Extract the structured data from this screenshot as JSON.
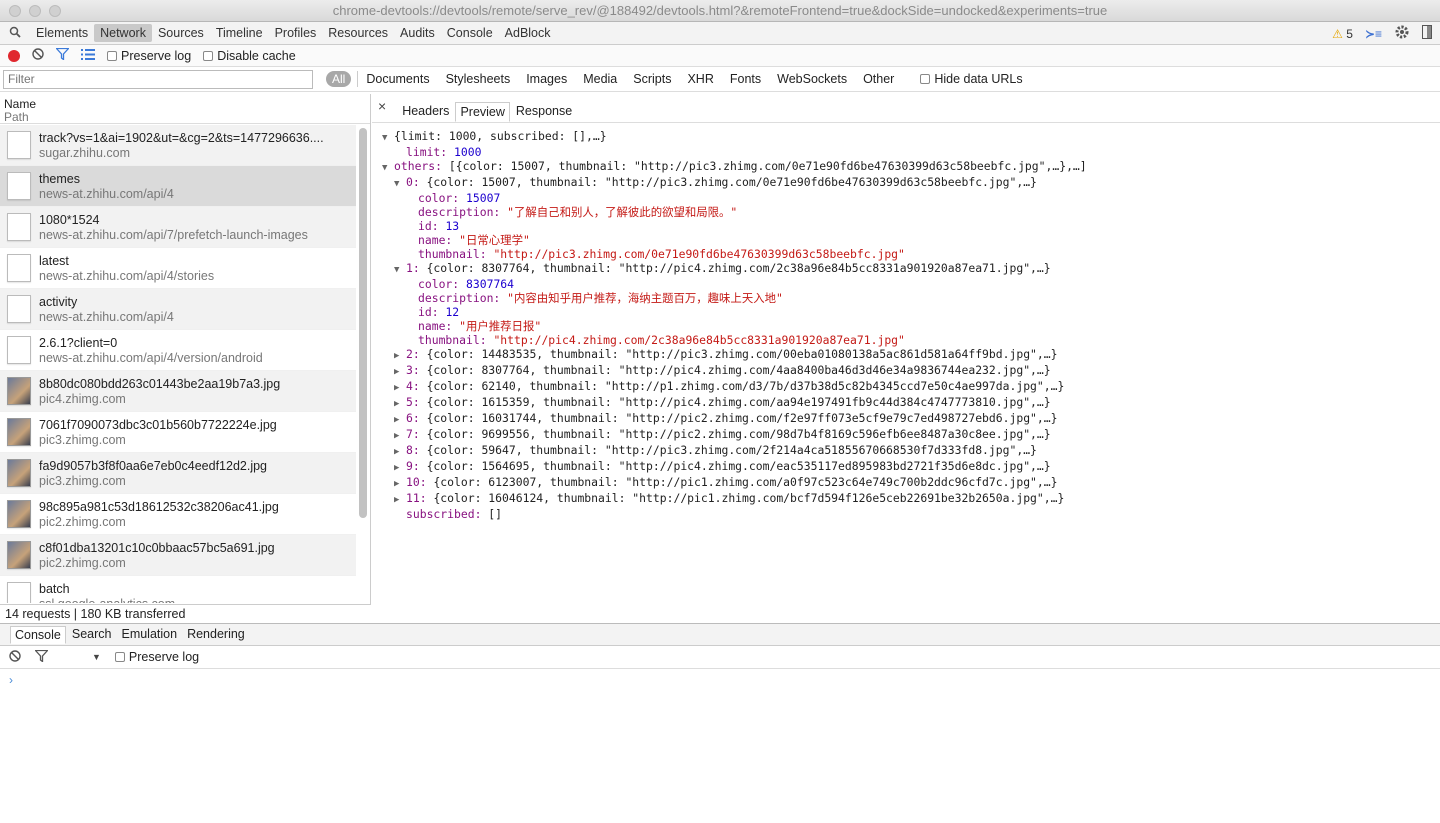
{
  "window": {
    "title": "chrome-devtools://devtools/remote/serve_rev/@188492/devtools.html?&remoteFrontend=true&dockSide=undocked&experiments=true"
  },
  "main_tabs": [
    "Elements",
    "Network",
    "Sources",
    "Timeline",
    "Profiles",
    "Resources",
    "Audits",
    "Console",
    "AdBlock"
  ],
  "active_main_tab": "Network",
  "warnings_count": "5",
  "network_toolbar": {
    "preserve_log_label": "Preserve log",
    "disable_cache_label": "Disable cache"
  },
  "filter": {
    "placeholder": "Filter",
    "all_label": "All",
    "types": [
      "Documents",
      "Stylesheets",
      "Images",
      "Media",
      "Scripts",
      "XHR",
      "Fonts",
      "WebSockets",
      "Other"
    ],
    "hide_data_urls_label": "Hide data URLs"
  },
  "list_header": {
    "name": "Name",
    "path": "Path"
  },
  "requests": [
    {
      "name": "track?vs=1&ai=1902&ut=&cg=2&ts=1477296636....",
      "path": "sugar.zhihu.com",
      "icon": "document-icon"
    },
    {
      "name": "themes",
      "path": "news-at.zhihu.com/api/4",
      "icon": "document-icon",
      "selected": true
    },
    {
      "name": "1080*1524",
      "path": "news-at.zhihu.com/api/7/prefetch-launch-images",
      "icon": "document-icon"
    },
    {
      "name": "latest",
      "path": "news-at.zhihu.com/api/4/stories",
      "icon": "document-icon"
    },
    {
      "name": "activity",
      "path": "news-at.zhihu.com/api/4",
      "icon": "document-icon"
    },
    {
      "name": "2.6.1?client=0",
      "path": "news-at.zhihu.com/api/4/version/android",
      "icon": "document-icon"
    },
    {
      "name": "8b80dc080bdd263c01443be2aa19b7a3.jpg",
      "path": "pic4.zhimg.com",
      "icon": "image-thumbnail-icon"
    },
    {
      "name": "7061f7090073dbc3c01b560b7722224e.jpg",
      "path": "pic3.zhimg.com",
      "icon": "image-thumbnail-icon"
    },
    {
      "name": "fa9d9057b3f8f0aa6e7eb0c4eedf12d2.jpg",
      "path": "pic3.zhimg.com",
      "icon": "image-thumbnail-icon"
    },
    {
      "name": "98c895a981c53d18612532c38206ac41.jpg",
      "path": "pic2.zhimg.com",
      "icon": "image-thumbnail-icon"
    },
    {
      "name": "c8f01dba13201c10c0bbaac57bc5a691.jpg",
      "path": "pic2.zhimg.com",
      "icon": "image-thumbnail-icon"
    },
    {
      "name": "batch",
      "path": "ssl.google-analytics.com",
      "icon": "document-icon"
    }
  ],
  "summary": "14 requests | 180 KB transferred",
  "detail_tabs": [
    "Headers",
    "Preview",
    "Response"
  ],
  "active_detail_tab": "Preview",
  "preview_lines": [
    {
      "indent": 0,
      "arrow": "▼",
      "parts": [
        [
          "plain",
          "{limit: 1000, subscribed: [],…}"
        ]
      ]
    },
    {
      "indent": 1,
      "arrow": "",
      "parts": [
        [
          "key",
          "limit: "
        ],
        [
          "num",
          "1000"
        ]
      ]
    },
    {
      "indent": 0,
      "arrow": "▼",
      "parts": [
        [
          "key",
          "others: "
        ],
        [
          "plain",
          "[{color: 15007, thumbnail: \"http://pic3.zhimg.com/0e71e90fd6be47630399d63c58beebfc.jpg\",…},…]"
        ]
      ]
    },
    {
      "indent": 1,
      "arrow": "▼",
      "parts": [
        [
          "key",
          "0: "
        ],
        [
          "plain",
          "{color: 15007, thumbnail: \"http://pic3.zhimg.com/0e71e90fd6be47630399d63c58beebfc.jpg\",…}"
        ]
      ]
    },
    {
      "indent": 2,
      "arrow": "",
      "parts": [
        [
          "key",
          "color: "
        ],
        [
          "num",
          "15007"
        ]
      ]
    },
    {
      "indent": 2,
      "arrow": "",
      "parts": [
        [
          "key",
          "description: "
        ],
        [
          "str",
          "\"了解自己和别人，了解彼此的欲望和局限。\""
        ]
      ]
    },
    {
      "indent": 2,
      "arrow": "",
      "parts": [
        [
          "key",
          "id: "
        ],
        [
          "num",
          "13"
        ]
      ]
    },
    {
      "indent": 2,
      "arrow": "",
      "parts": [
        [
          "key",
          "name: "
        ],
        [
          "str",
          "\"日常心理学\""
        ]
      ]
    },
    {
      "indent": 2,
      "arrow": "",
      "parts": [
        [
          "key",
          "thumbnail: "
        ],
        [
          "str",
          "\"http://pic3.zhimg.com/0e71e90fd6be47630399d63c58beebfc.jpg\""
        ]
      ]
    },
    {
      "indent": 1,
      "arrow": "▼",
      "parts": [
        [
          "key",
          "1: "
        ],
        [
          "plain",
          "{color: 8307764, thumbnail: \"http://pic4.zhimg.com/2c38a96e84b5cc8331a901920a87ea71.jpg\",…}"
        ]
      ]
    },
    {
      "indent": 2,
      "arrow": "",
      "parts": [
        [
          "key",
          "color: "
        ],
        [
          "num",
          "8307764"
        ]
      ]
    },
    {
      "indent": 2,
      "arrow": "",
      "parts": [
        [
          "key",
          "description: "
        ],
        [
          "str",
          "\"内容由知乎用户推荐，海纳主题百万，趣味上天入地\""
        ]
      ]
    },
    {
      "indent": 2,
      "arrow": "",
      "parts": [
        [
          "key",
          "id: "
        ],
        [
          "num",
          "12"
        ]
      ]
    },
    {
      "indent": 2,
      "arrow": "",
      "parts": [
        [
          "key",
          "name: "
        ],
        [
          "str",
          "\"用户推荐日报\""
        ]
      ]
    },
    {
      "indent": 2,
      "arrow": "",
      "parts": [
        [
          "key",
          "thumbnail: "
        ],
        [
          "str",
          "\"http://pic4.zhimg.com/2c38a96e84b5cc8331a901920a87ea71.jpg\""
        ]
      ]
    },
    {
      "indent": 1,
      "arrow": "▶",
      "parts": [
        [
          "key",
          "2: "
        ],
        [
          "plain",
          "{color: 14483535, thumbnail: \"http://pic3.zhimg.com/00eba01080138a5ac861d581a64ff9bd.jpg\",…}"
        ]
      ]
    },
    {
      "indent": 1,
      "arrow": "▶",
      "parts": [
        [
          "key",
          "3: "
        ],
        [
          "plain",
          "{color: 8307764, thumbnail: \"http://pic4.zhimg.com/4aa8400ba46d3d46e34a9836744ea232.jpg\",…}"
        ]
      ]
    },
    {
      "indent": 1,
      "arrow": "▶",
      "parts": [
        [
          "key",
          "4: "
        ],
        [
          "plain",
          "{color: 62140, thumbnail: \"http://p1.zhimg.com/d3/7b/d37b38d5c82b4345ccd7e50c4ae997da.jpg\",…}"
        ]
      ]
    },
    {
      "indent": 1,
      "arrow": "▶",
      "parts": [
        [
          "key",
          "5: "
        ],
        [
          "plain",
          "{color: 1615359, thumbnail: \"http://pic4.zhimg.com/aa94e197491fb9c44d384c4747773810.jpg\",…}"
        ]
      ]
    },
    {
      "indent": 1,
      "arrow": "▶",
      "parts": [
        [
          "key",
          "6: "
        ],
        [
          "plain",
          "{color: 16031744, thumbnail: \"http://pic2.zhimg.com/f2e97ff073e5cf9e79c7ed498727ebd6.jpg\",…}"
        ]
      ]
    },
    {
      "indent": 1,
      "arrow": "▶",
      "parts": [
        [
          "key",
          "7: "
        ],
        [
          "plain",
          "{color: 9699556, thumbnail: \"http://pic2.zhimg.com/98d7b4f8169c596efb6ee8487a30c8ee.jpg\",…}"
        ]
      ]
    },
    {
      "indent": 1,
      "arrow": "▶",
      "parts": [
        [
          "key",
          "8: "
        ],
        [
          "plain",
          "{color: 59647, thumbnail: \"http://pic3.zhimg.com/2f214a4ca51855670668530f7d333fd8.jpg\",…}"
        ]
      ]
    },
    {
      "indent": 1,
      "arrow": "▶",
      "parts": [
        [
          "key",
          "9: "
        ],
        [
          "plain",
          "{color: 1564695, thumbnail: \"http://pic4.zhimg.com/eac535117ed895983bd2721f35d6e8dc.jpg\",…}"
        ]
      ]
    },
    {
      "indent": 1,
      "arrow": "▶",
      "parts": [
        [
          "key",
          "10: "
        ],
        [
          "plain",
          "{color: 6123007, thumbnail: \"http://pic1.zhimg.com/a0f97c523c64e749c700b2ddc96cfd7c.jpg\",…}"
        ]
      ]
    },
    {
      "indent": 1,
      "arrow": "▶",
      "parts": [
        [
          "key",
          "11: "
        ],
        [
          "plain",
          "{color: 16046124, thumbnail: \"http://pic1.zhimg.com/bcf7d594f126e5ceb22691be32b2650a.jpg\",…}"
        ]
      ]
    },
    {
      "indent": 1,
      "arrow": "",
      "parts": [
        [
          "key",
          "subscribed: "
        ],
        [
          "plain",
          "[]"
        ]
      ]
    }
  ],
  "drawer_tabs": [
    "Console",
    "Search",
    "Emulation",
    "Rendering"
  ],
  "active_drawer_tab": "Console",
  "drawer_toolbar": {
    "preserve_log_label": "Preserve log"
  },
  "console_prompt": "›",
  "colors": {
    "record": "#e0282e",
    "key": "#881280",
    "number": "#1c00cf",
    "string": "#c41a16",
    "selected_row": "#dadada"
  }
}
